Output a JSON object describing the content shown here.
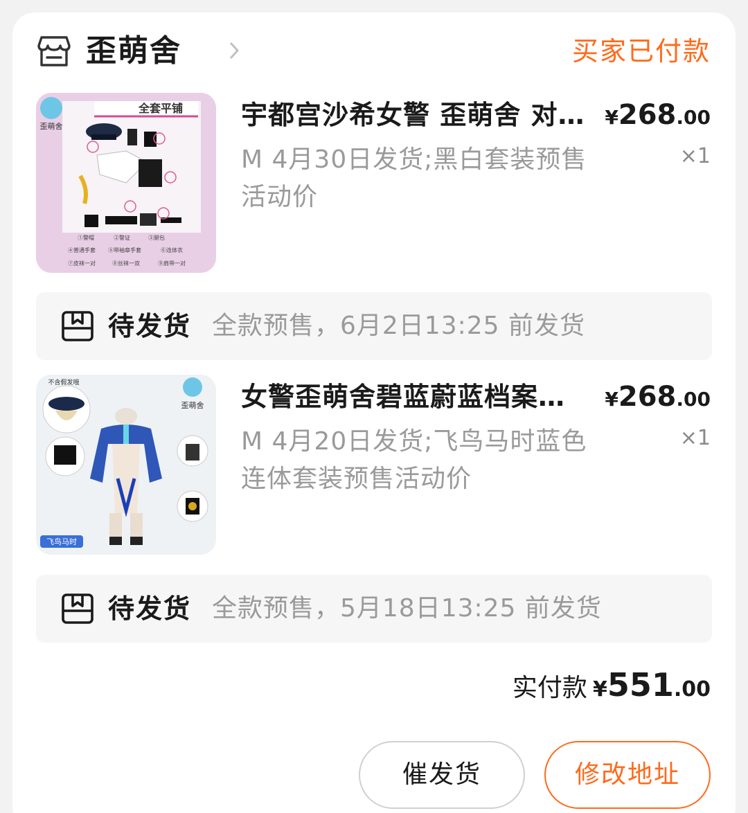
{
  "shop": {
    "name": "歪萌舍",
    "order_status": "买家已付款",
    "icon": "store-icon"
  },
  "items": [
    {
      "title": "宇都宫沙希女警 歪萌舍 对…",
      "price_symbol": "¥",
      "price_int": "268",
      "price_dec": ".00",
      "spec": "M  4月30日发货;黑白套装预售活动价",
      "qty": "×1",
      "shipping_status": "待发货",
      "shipping_note": "全款预售，6月2日13:25 前发货",
      "thumb": {
        "banner": "全套平铺",
        "brand": "歪萌舍",
        "legend": [
          "①警帽",
          "②警证",
          "③腿包",
          "④普通手套",
          "⑤带袖章手套",
          "⑥连体衣",
          "⑦皮袜一对",
          "⑧丝袜一双",
          "⑨肩带一对"
        ]
      }
    },
    {
      "title": "女警歪萌舍碧蓝蔚蓝档案…",
      "price_symbol": "¥",
      "price_int": "268",
      "price_dec": ".00",
      "spec": "M  4月20日发货;飞鸟马时蓝色连体套装预售活动价",
      "qty": "×1",
      "shipping_status": "待发货",
      "shipping_note": "全款预售，5月18日13:25 前发货",
      "thumb": {
        "note": "不含假发哦",
        "brand": "歪萌舍",
        "character": "飞鸟马时"
      }
    }
  ],
  "total": {
    "label": "实付款",
    "symbol": "¥",
    "int": "551",
    "dec": ".00"
  },
  "buttons": {
    "remind": "催发货",
    "address": "修改地址"
  },
  "colors": {
    "accent": "#ff6a1a",
    "muted_text": "#9a9a9a",
    "ship_bar_bg": "#f6f6f6"
  }
}
